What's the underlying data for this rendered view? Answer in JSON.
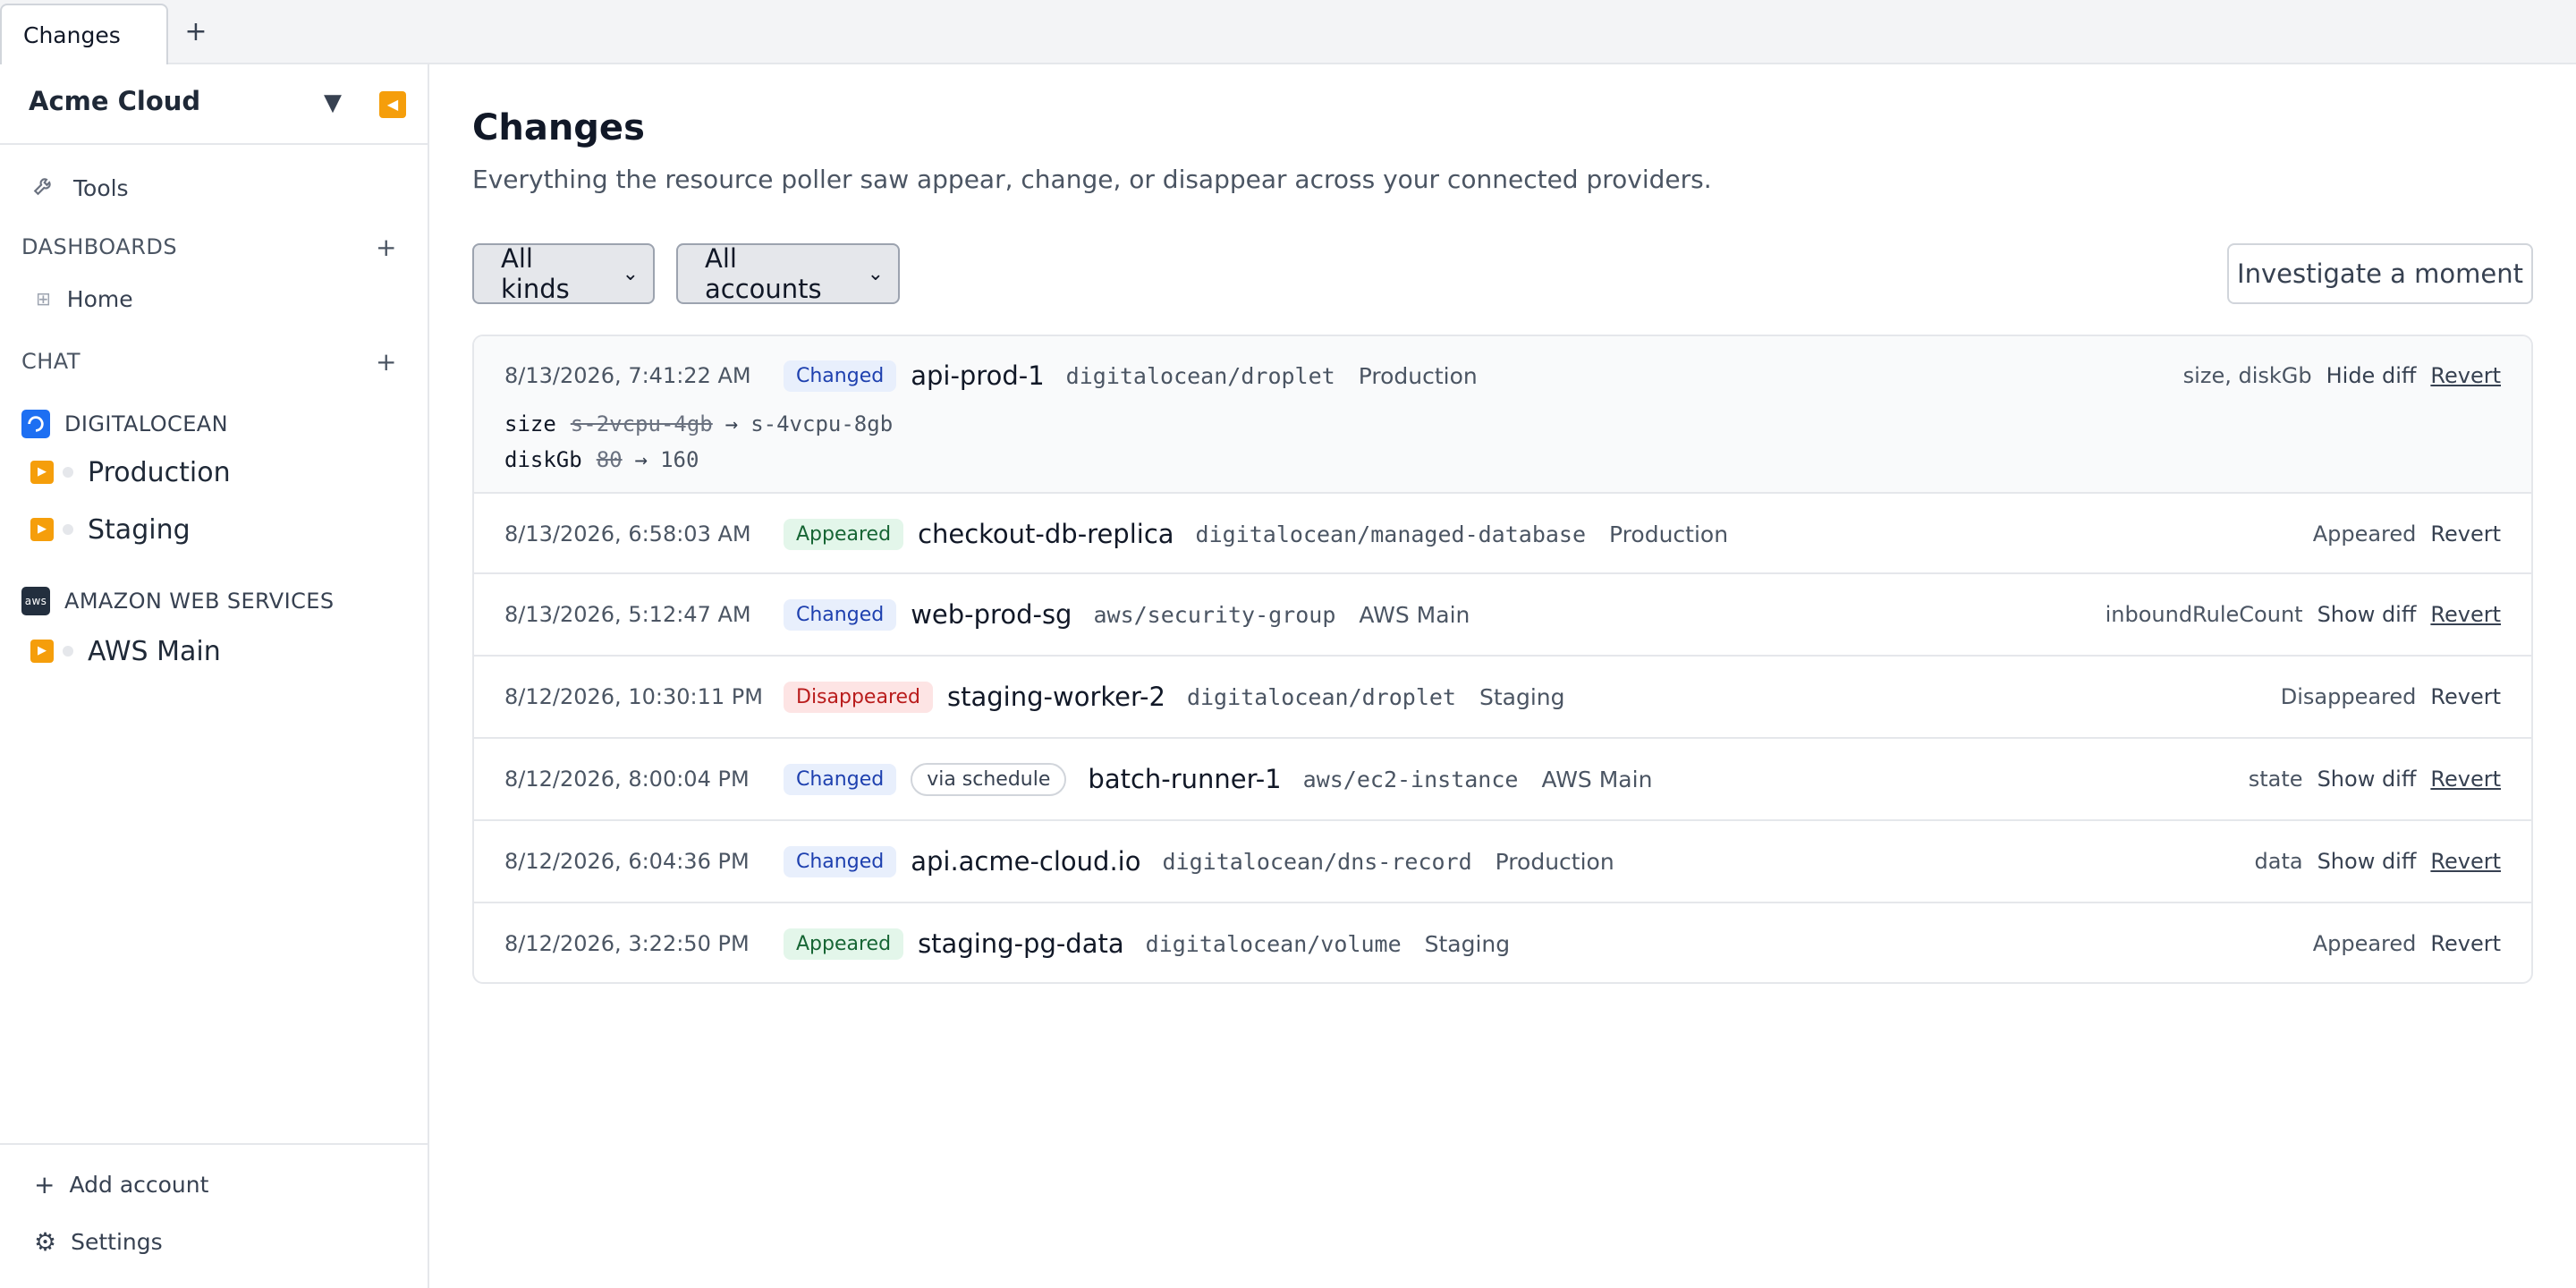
{
  "tabs": {
    "active_label": "Changes",
    "add_label": "+"
  },
  "sidebar": {
    "org_name": "Acme Cloud",
    "caret": "▼",
    "collapse": "◀",
    "tools_label": "Tools",
    "dashboards": {
      "title": "DASHBOARDS",
      "add": "+",
      "items": [
        {
          "label": "Home"
        }
      ]
    },
    "chat": {
      "title": "CHAT",
      "add": "+"
    },
    "providers": [
      {
        "name": "DIGITALOCEAN",
        "accounts": [
          {
            "label": "Production"
          },
          {
            "label": "Staging"
          }
        ]
      },
      {
        "name": "AMAZON WEB SERVICES",
        "logo_text": "aws",
        "accounts": [
          {
            "label": "AWS Main"
          }
        ]
      }
    ],
    "footer": {
      "add_account": "Add account",
      "settings": "Settings"
    }
  },
  "main": {
    "title": "Changes",
    "subtitle": "Everything the resource poller saw appear, change, or disappear across your connected providers.",
    "filters": {
      "kind": "All kinds",
      "account": "All accounts"
    },
    "investigate_label": "Investigate a moment",
    "changes": [
      {
        "timestamp": "8/13/2026, 7:41:22 AM",
        "status": "Changed",
        "name": "api-prod-1",
        "type": "digitalocean/droplet",
        "account": "Production",
        "fields": "size, diskGb",
        "diff_toggle": "Hide diff",
        "revert": "Revert",
        "diff": [
          {
            "field": "size",
            "old": "s-2vcpu-4gb",
            "arrow": "→",
            "new": "s-4vcpu-8gb"
          },
          {
            "field": "diskGb",
            "old": "80",
            "arrow": "→",
            "new": "160"
          }
        ]
      },
      {
        "timestamp": "8/13/2026, 6:58:03 AM",
        "status": "Appeared",
        "name": "checkout-db-replica",
        "type": "digitalocean/managed-database",
        "account": "Production",
        "fields": "Appeared",
        "revert": "Revert"
      },
      {
        "timestamp": "8/13/2026, 5:12:47 AM",
        "status": "Changed",
        "name": "web-prod-sg",
        "type": "aws/security-group",
        "account": "AWS Main",
        "fields": "inboundRuleCount",
        "diff_toggle": "Show diff",
        "revert": "Revert"
      },
      {
        "timestamp": "8/12/2026, 10:30:11 PM",
        "status": "Disappeared",
        "name": "staging-worker-2",
        "type": "digitalocean/droplet",
        "account": "Staging",
        "fields": "Disappeared",
        "revert": "Revert"
      },
      {
        "timestamp": "8/12/2026, 8:00:04 PM",
        "status": "Changed",
        "via": "via schedule",
        "name": "batch-runner-1",
        "type": "aws/ec2-instance",
        "account": "AWS Main",
        "fields": "state",
        "diff_toggle": "Show diff",
        "revert": "Revert"
      },
      {
        "timestamp": "8/12/2026, 6:04:36 PM",
        "status": "Changed",
        "name": "api.acme-cloud.io",
        "type": "digitalocean/dns-record",
        "account": "Production",
        "fields": "data",
        "diff_toggle": "Show diff",
        "revert": "Revert"
      },
      {
        "timestamp": "8/12/2026, 3:22:50 PM",
        "status": "Appeared",
        "name": "staging-pg-data",
        "type": "digitalocean/volume",
        "account": "Staging",
        "fields": "Appeared",
        "revert": "Revert"
      }
    ]
  },
  "colors": {
    "accent_orange": "#f59e0b",
    "changed_badge": "#1e40af",
    "appeared_badge": "#166534",
    "disappeared_badge": "#b91c1c",
    "digitalocean_blue": "#1d6ff2"
  }
}
